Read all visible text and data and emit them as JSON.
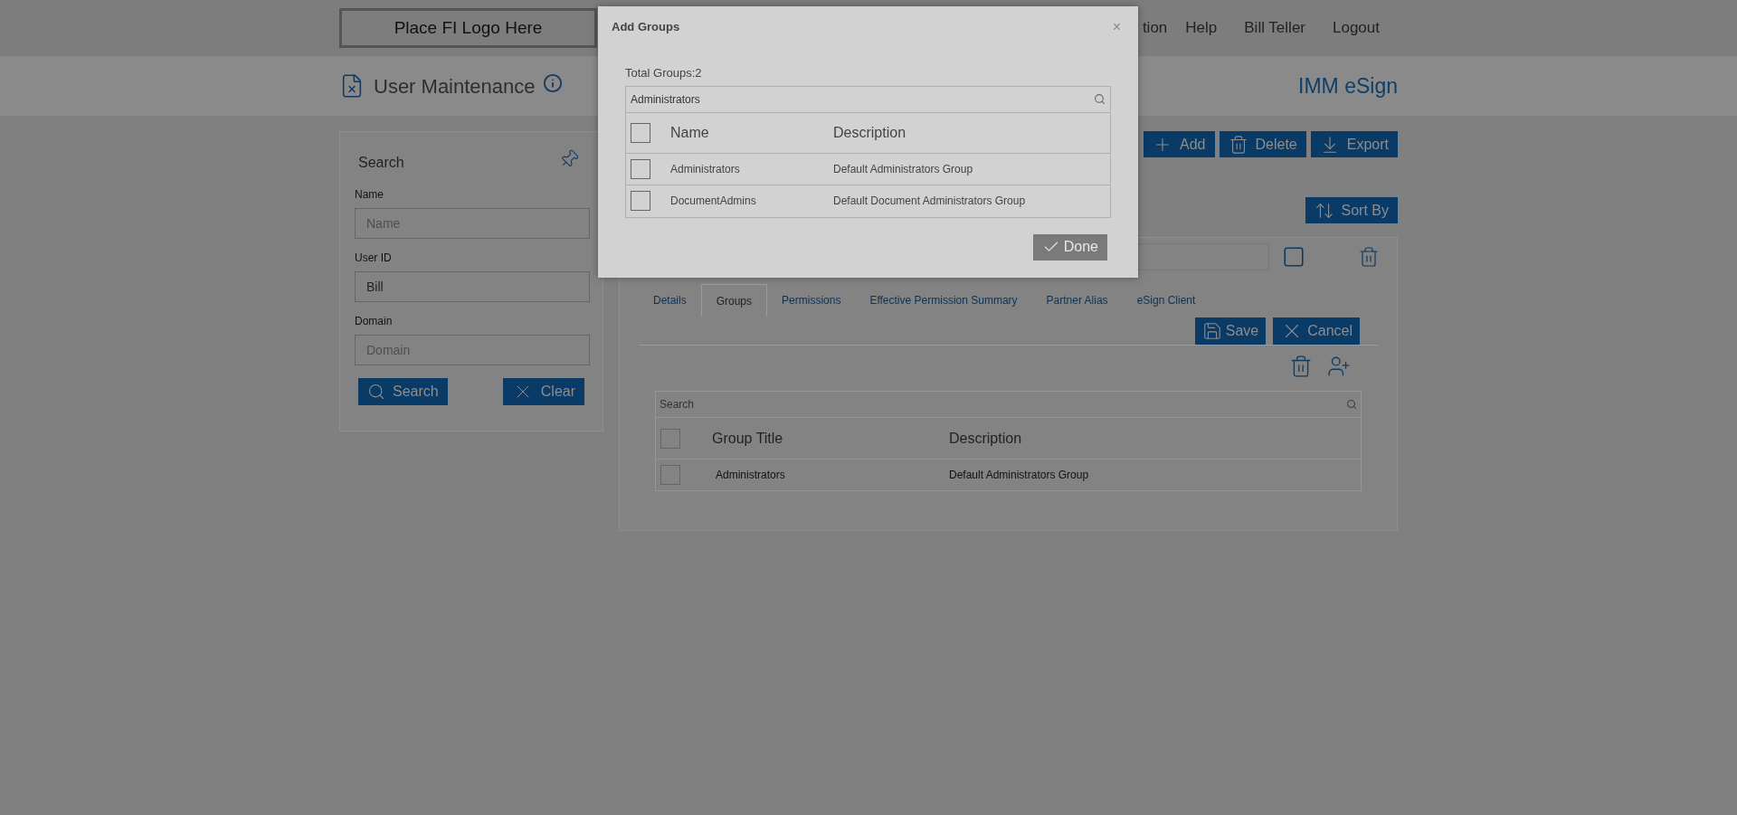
{
  "header": {
    "logo": "Place FI Logo Here",
    "nav": [
      {
        "label": "tion"
      },
      {
        "label": "Help"
      },
      {
        "label": "Bill Teller"
      },
      {
        "label": "Logout"
      }
    ]
  },
  "page": {
    "title": "User Maintenance",
    "product": "IMM eSign"
  },
  "search_panel": {
    "title": "Search",
    "fields": [
      {
        "label": "Name",
        "placeholder": "Name"
      },
      {
        "label": "User ID",
        "value": "Bill"
      },
      {
        "label": "Domain",
        "placeholder": "Domain"
      }
    ],
    "buttons": [
      "Search",
      "Clear"
    ]
  },
  "toolbar": [
    "Add",
    "Delete",
    "Export"
  ],
  "results": {
    "sort_by": "Sort By"
  },
  "user_card": {
    "tabs": [
      {
        "label": "Details",
        "selected": false
      },
      {
        "label": "Groups",
        "selected": true
      },
      {
        "label": "Permissions",
        "selected": false
      },
      {
        "label": "Effective Permission Summary",
        "selected": false
      },
      {
        "label": "Partner Alias",
        "selected": false
      },
      {
        "label": "eSign Client",
        "selected": false
      }
    ],
    "buttons": [
      "Save",
      "Cancel"
    ],
    "groups_table": {
      "search_placeholder": "Search",
      "header_checked": false,
      "columns": [
        "Group Title",
        "Description"
      ],
      "rows": [
        {
          "checked": false,
          "title": "Administrators",
          "description": "Default Administrators Group"
        }
      ]
    }
  },
  "dialog": {
    "title": "Add Groups",
    "close": "×",
    "total": "Total Groups:2",
    "search_value": "Administrators",
    "header_checked": false,
    "columns": [
      "Name",
      "Description"
    ],
    "rows": [
      {
        "checked": false,
        "name": "Administrators",
        "description": "Default Administrators Group"
      },
      {
        "checked": false,
        "name": "DocumentAdmins",
        "description": "Default Document Administrators Group"
      }
    ],
    "done": "Done"
  }
}
